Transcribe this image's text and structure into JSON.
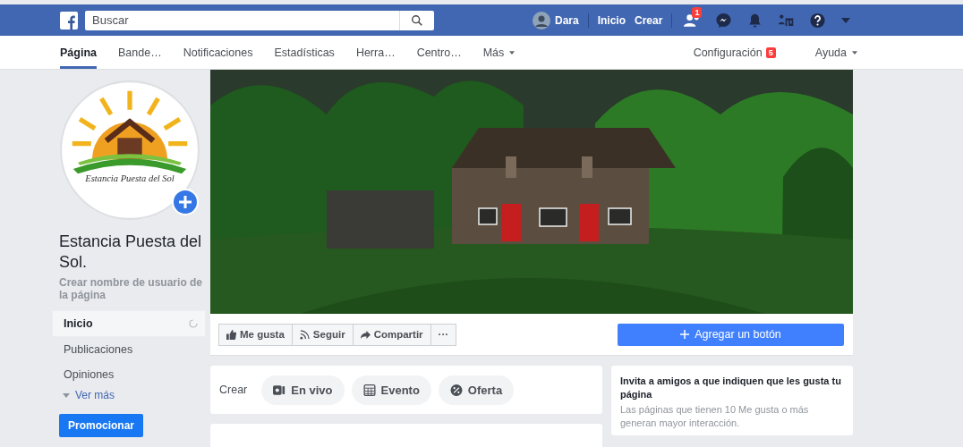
{
  "topbar": {
    "search": {
      "placeholder": "Buscar"
    },
    "profile_name": "Dara",
    "links": [
      "Inicio",
      "Crear"
    ],
    "friend_requests_badge": "1"
  },
  "page_tabs": [
    {
      "label": "Página",
      "selected": true
    },
    {
      "label": "Bande…",
      "selected": false
    },
    {
      "label": "Notificaciones",
      "selected": false
    },
    {
      "label": "Estadísticas",
      "selected": false
    },
    {
      "label": "Herra…",
      "selected": false
    },
    {
      "label": "Centro…",
      "selected": false
    },
    {
      "label": "Más",
      "selected": false,
      "dropdown": true
    }
  ],
  "page_tabs_right": [
    {
      "label": "Configuración",
      "badge": "5"
    },
    {
      "label": "Ayuda",
      "dropdown": true
    }
  ],
  "sidebar": {
    "logo_caption": "Estancia Puesta del Sol",
    "page_name": "Estancia Puesta del Sol.",
    "username_link": "Crear nombre de usuario de la página",
    "items": [
      {
        "label": "Inicio",
        "selected": true
      },
      {
        "label": "Publicaciones",
        "selected": false
      },
      {
        "label": "Opiniones",
        "selected": false
      }
    ],
    "more": "Ver más",
    "promote_button": "Promocionar"
  },
  "actions": [
    "Me gusta",
    "Seguir",
    "Compartir",
    "···"
  ],
  "add_button": "Agregar un botón",
  "create": {
    "label": "Crear",
    "options": [
      {
        "kind": "live",
        "label": "En vivo"
      },
      {
        "kind": "event",
        "label": "Evento"
      },
      {
        "kind": "offer",
        "label": "Oferta"
      }
    ]
  },
  "invite_card": {
    "title": "Invita a amigos a que indiquen que les gusta tu página",
    "text": "Las páginas que tienen 10 Me gusta o más generan mayor interacción."
  }
}
